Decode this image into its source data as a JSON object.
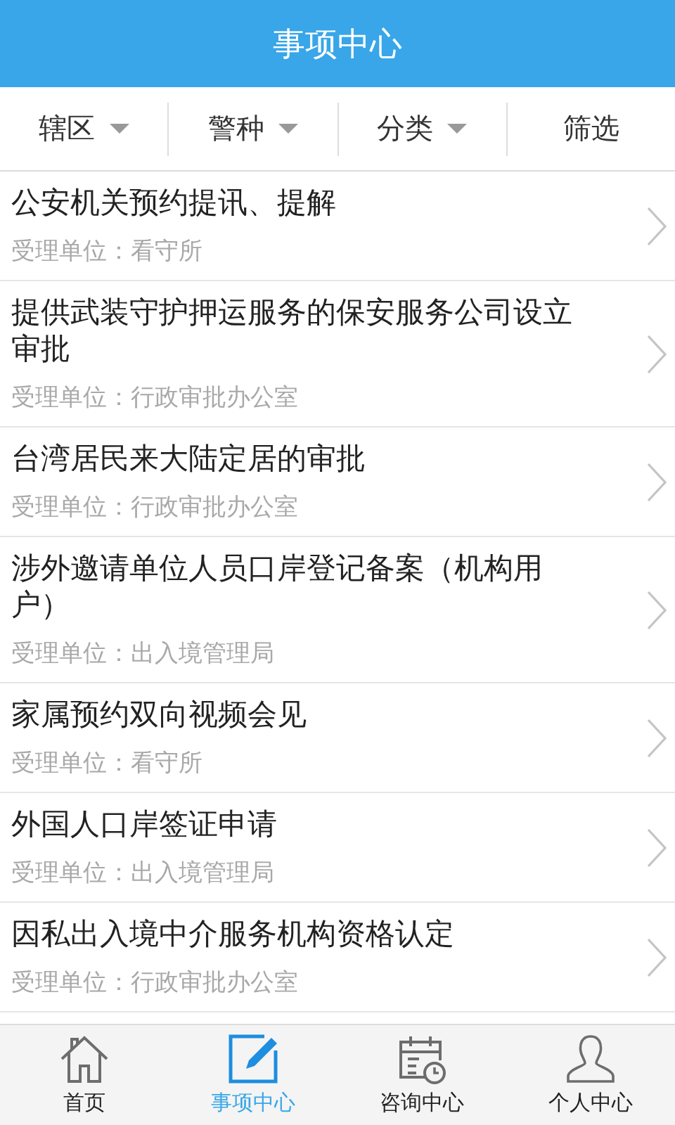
{
  "header": {
    "title": "事项中心"
  },
  "filters": [
    {
      "label": "辖区",
      "kind": "dropdown"
    },
    {
      "label": "警种",
      "kind": "dropdown"
    },
    {
      "label": "分类",
      "kind": "dropdown"
    },
    {
      "label": "筛选",
      "kind": "plain"
    }
  ],
  "items": [
    {
      "title": "公安机关预约提讯、提解",
      "unit": "受理单位：看守所"
    },
    {
      "title": "提供武装守护押运服务的保安服务公司设立审批",
      "unit": "受理单位：行政审批办公室"
    },
    {
      "title": "台湾居民来大陆定居的审批",
      "unit": "受理单位：行政审批办公室"
    },
    {
      "title": "涉外邀请单位人员口岸登记备案（机构用户）",
      "unit": "受理单位：出入境管理局"
    },
    {
      "title": "家属预约双向视频会见",
      "unit": "受理单位：看守所"
    },
    {
      "title": "外国人口岸签证申请",
      "unit": "受理单位：出入境管理局"
    },
    {
      "title": "因私出入境中介服务机构资格认定",
      "unit": "受理单位：行政审批办公室"
    }
  ],
  "tabs": [
    {
      "label": "首页",
      "kind": "home",
      "selected": false
    },
    {
      "label": "事项中心",
      "kind": "edit",
      "selected": true
    },
    {
      "label": "咨询中心",
      "kind": "calendar",
      "selected": false
    },
    {
      "label": "个人中心",
      "kind": "person",
      "selected": false
    }
  ]
}
